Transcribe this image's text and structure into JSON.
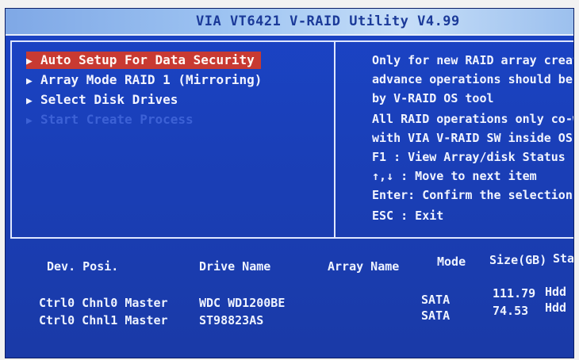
{
  "title": "VIA VT6421 V-RAID Utility V4.99",
  "menu": {
    "items": [
      {
        "label": "Auto Setup For Data Security",
        "selected": true,
        "disabled": false
      },
      {
        "label": "Array Mode RAID 1 (Mirroring)",
        "selected": false,
        "disabled": false
      },
      {
        "label": "Select Disk Drives",
        "selected": false,
        "disabled": false
      },
      {
        "label": "Start Create Process",
        "selected": false,
        "disabled": true
      }
    ]
  },
  "help": {
    "lines": [
      "Only for new RAID array creat",
      "advance operations should be",
      "by V-RAID OS tool",
      "All RAID operations only co-w",
      "with VIA V-RAID SW inside OS",
      "F1   : View Array/disk Status",
      "↑,↓  : Move to next item",
      "Enter: Confirm the selection",
      "ESC  : Exit"
    ]
  },
  "disks": {
    "headers": {
      "dev_posi": "Dev. Posi.",
      "drive_name": "Drive Name",
      "array_name": "Array Name",
      "mode": "Mode",
      "size": "Size(GB)",
      "status": "Sta"
    },
    "rows": [
      {
        "dev_posi": "Ctrl0 Chnl0 Master",
        "drive_name": "WDC WD1200BE",
        "array_name": "",
        "mode": "SATA",
        "size": "111.79",
        "status": "Hdd"
      },
      {
        "dev_posi": "Ctrl0 Chnl1 Master",
        "drive_name": "ST98823AS",
        "array_name": "",
        "mode": "SATA",
        "size": "74.53",
        "status": "Hdd"
      }
    ]
  },
  "colors": {
    "background": "#1a40b5",
    "title_bar": "#9ec4f2",
    "title_text": "#1b3a99",
    "highlight": "#c83a32",
    "text": "#f2f4ff",
    "disabled_text": "#3c61d6"
  }
}
